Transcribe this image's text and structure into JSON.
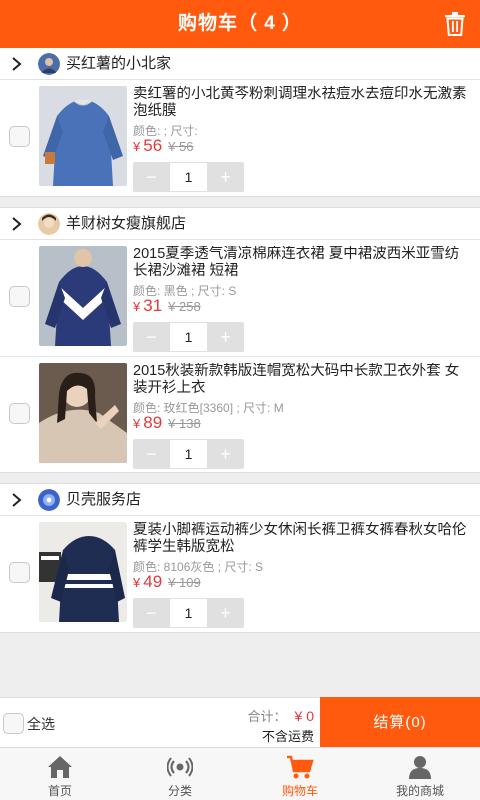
{
  "header": {
    "title": "购物车（ 4 ）"
  },
  "colors": {
    "accent": "#ff5a0e",
    "price": "#e4393c"
  },
  "shops": [
    {
      "name": "买红薯的小北家",
      "items": [
        {
          "name": "卖红薯的小北黄芩粉刺调理水祛痘水去痘印水无激素泡纸膜",
          "attr": "颜色: ; 尺寸:",
          "currency": "¥",
          "price": "56",
          "old_price": "¥ 56",
          "qty": "1"
        }
      ]
    },
    {
      "name": "羊财树女瘦旗舰店",
      "items": [
        {
          "name": "2015夏季透气清凉棉麻连衣裙 夏中裙波西米亚雪纺长裙沙滩裙 短裙",
          "attr": "颜色: 黑色 ; 尺寸: S",
          "currency": "¥",
          "price": "31",
          "old_price": "¥ 258",
          "qty": "1"
        },
        {
          "name": "2015秋装新款韩版连帽宽松大码中长款卫衣外套 女装开衫上衣",
          "attr": "颜色: 玫红色[3360] ; 尺寸: M",
          "currency": "¥",
          "price": "89",
          "old_price": "¥ 138",
          "qty": "1"
        }
      ]
    },
    {
      "name": "贝壳服务店",
      "items": [
        {
          "name": "夏装小脚裤运动裤少女休闲长裤卫裤女裤春秋女哈伦裤学生韩版宽松",
          "attr": "颜色: 8106灰色 ; 尺寸: S",
          "currency": "¥",
          "price": "49",
          "old_price": "¥ 109",
          "qty": "1"
        }
      ]
    }
  ],
  "stepper": {
    "minus": "−",
    "plus": "+"
  },
  "footer": {
    "select_all": "全选",
    "total_label": "合计：",
    "total_amount": "¥ 0",
    "shipping_note": "不含运费",
    "checkout": "结算(0)"
  },
  "tabs": [
    {
      "label": "首页",
      "icon": "home-icon"
    },
    {
      "label": "分类",
      "icon": "broadcast-icon"
    },
    {
      "label": "购物车",
      "icon": "cart-icon",
      "active": true
    },
    {
      "label": "我的商城",
      "icon": "user-icon"
    }
  ]
}
